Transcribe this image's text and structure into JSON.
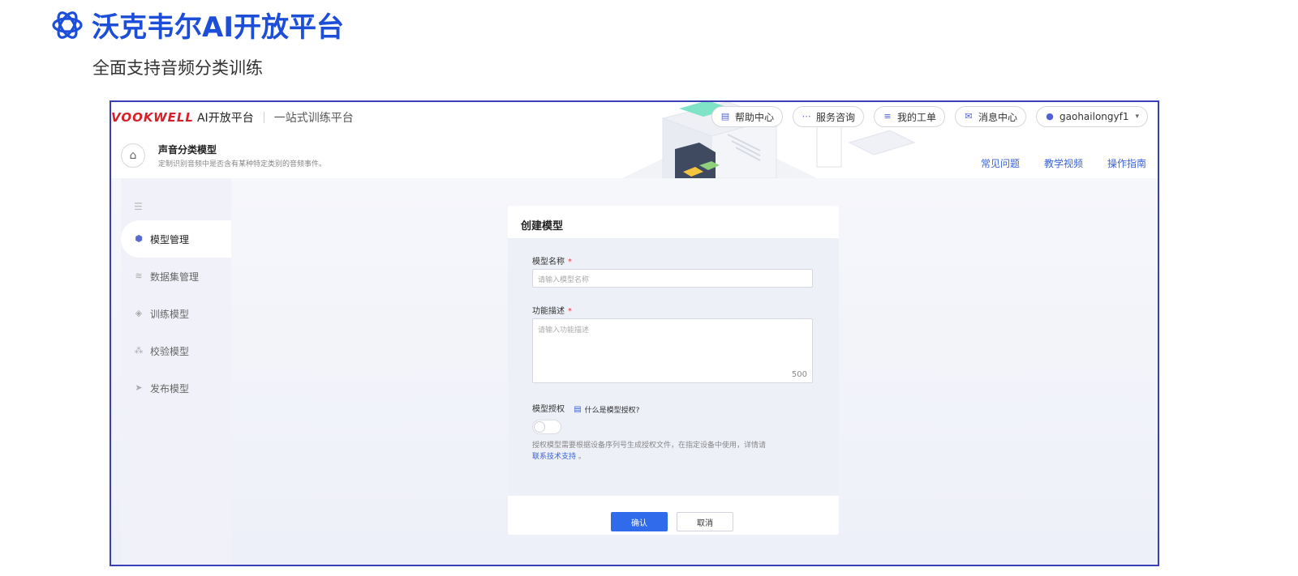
{
  "hero": {
    "title": "沃克韦尔AI开放平台",
    "subtitle": "全面支持音频分类训练"
  },
  "app": {
    "brand_mark": "VOOKWELL",
    "brand_platform": "AI开放平台",
    "brand_suite": "一站式训练平台",
    "top_actions": [
      {
        "label": "帮助中心",
        "icon": "document-icon"
      },
      {
        "label": "服务咨询",
        "icon": "chat-dots-icon"
      },
      {
        "label": "我的工单",
        "icon": "ticket-icon"
      },
      {
        "label": "消息中心",
        "icon": "mail-icon"
      }
    ],
    "user": {
      "name": "gaohailongyf1",
      "icon": "user-icon"
    },
    "model": {
      "name": "声音分类模型",
      "description": "定制识别音频中是否含有某种特定类别的音频事件。"
    },
    "help_links": [
      "常见问题",
      "教学视频",
      "操作指南"
    ],
    "accent_color": "#2f6bea"
  },
  "sidebar": {
    "items": [
      {
        "label": "模型管理",
        "icon": "cube-icon",
        "active": true
      },
      {
        "label": "数据集管理",
        "icon": "database-icon",
        "active": false
      },
      {
        "label": "训练模型",
        "icon": "layers-icon",
        "active": false
      },
      {
        "label": "校验模型",
        "icon": "nodes-icon",
        "active": false
      },
      {
        "label": "发布模型",
        "icon": "send-icon",
        "active": false
      }
    ]
  },
  "dialog": {
    "title": "创建模型",
    "name_label": "模型名称",
    "name_placeholder": "请输入模型名称",
    "desc_label": "功能描述",
    "desc_placeholder": "请输入功能描述",
    "desc_max": "500",
    "required_mark": "*",
    "auth_label": "模型授权",
    "auth_help": "什么是模型授权?",
    "auth_note": "授权模型需要根据设备序列号生成授权文件，在指定设备中使用，详情请",
    "auth_contact": "联系技术支持",
    "auth_note_end": "。",
    "confirm_label": "确认",
    "cancel_label": "取消"
  }
}
